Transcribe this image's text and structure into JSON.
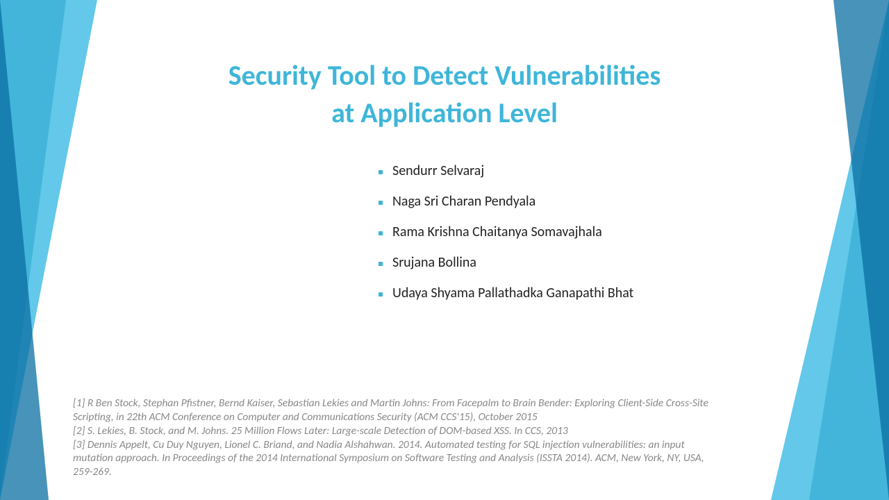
{
  "title_line1": "Security Tool to Detect Vulnerabilities",
  "title_line2": "at Application Level",
  "authors": [
    "Sendurr Selvaraj",
    "Naga Sri Charan Pendyala",
    "Rama Krishna Chaitanya Somavajhala",
    "Srujana Bollina",
    "Udaya Shyama Pallathadka Ganapathi Bhat"
  ],
  "references": [
    "[1] R Ben Stock, Stephan Pfistner, Bernd Kaiser, Sebastian Lekies and Martin Johns: From Facepalm to Brain Bender: Exploring Client-Side Cross-Site Scripting, in 22th ACM Conference on Computer and Communications Security (ACM CCS'15), October 2015",
    "[2] S. Lekies, B. Stock, and M. Johns. 25 Million Flows Later: Large-scale Detection of DOM-based XSS. In CCS, 2013",
    "[3] Dennis Appelt, Cu Duy Nguyen, Lionel C. Briand, and Nadia Alshahwan. 2014. Automated testing for SQL injection vulnerabilities: an input mutation approach. In Proceedings of the 2014 International Symposium on Software Testing and Analysis (ISSTA 2014). ACM, New York, NY, USA, 259-269."
  ]
}
